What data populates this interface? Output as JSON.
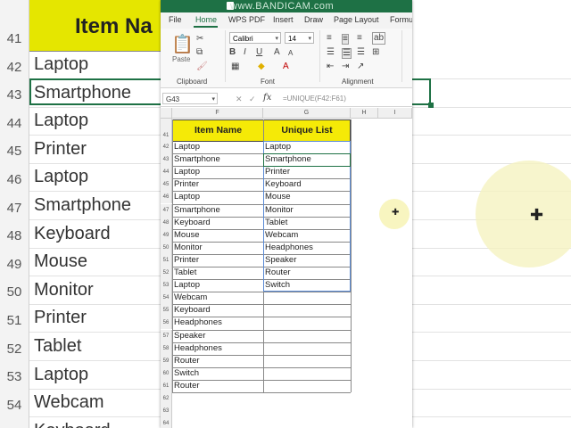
{
  "background": {
    "header": "Item Na",
    "row_numbers": [
      "41",
      "42",
      "43",
      "44",
      "45",
      "46",
      "47",
      "48",
      "49",
      "50",
      "51",
      "52",
      "53",
      "54",
      "55"
    ],
    "cells": [
      "Laptop",
      "Smartphone",
      "Laptop",
      "Printer",
      "Laptop",
      "Smartphone",
      "Keyboard",
      "Mouse",
      "Monitor",
      "Printer",
      "Tablet",
      "Laptop",
      "Webcam",
      "Keyboard"
    ]
  },
  "watermark": "www.BANDICAM.com",
  "tabs": [
    "File",
    "Home",
    "WPS PDF",
    "Insert",
    "Draw",
    "Page Layout",
    "Formu"
  ],
  "ribbon": {
    "paste": "Paste",
    "font_name": "Calibri",
    "font_size": "14",
    "groups": [
      "Clipboard",
      "Font",
      "Alignment"
    ]
  },
  "formula_bar": {
    "name_box": "G43",
    "fx": "fx",
    "formula": "=UNIQUE(F42:F61)"
  },
  "columns": [
    "F",
    "G",
    "H",
    "I"
  ],
  "rows": [
    "41",
    "42",
    "43",
    "44",
    "45",
    "46",
    "47",
    "48",
    "49",
    "50",
    "51",
    "52",
    "53",
    "54",
    "55",
    "56",
    "57",
    "58",
    "59",
    "60",
    "61",
    "62",
    "63",
    "64"
  ],
  "headers": {
    "item": "Item Name",
    "unique": "Unique List"
  },
  "items": [
    "Laptop",
    "Smartphone",
    "Laptop",
    "Printer",
    "Laptop",
    "Smartphone",
    "Keyboard",
    "Mouse",
    "Monitor",
    "Printer",
    "Tablet",
    "Laptop",
    "Webcam",
    "Keyboard",
    "Headphones",
    "Speaker",
    "Headphones",
    "Router",
    "Switch",
    "Router"
  ],
  "unique": [
    "Laptop",
    "Smartphone",
    "Printer",
    "Keyboard",
    "Mouse",
    "Monitor",
    "Tablet",
    "Webcam",
    "Headphones",
    "Speaker",
    "Router",
    "Switch"
  ]
}
